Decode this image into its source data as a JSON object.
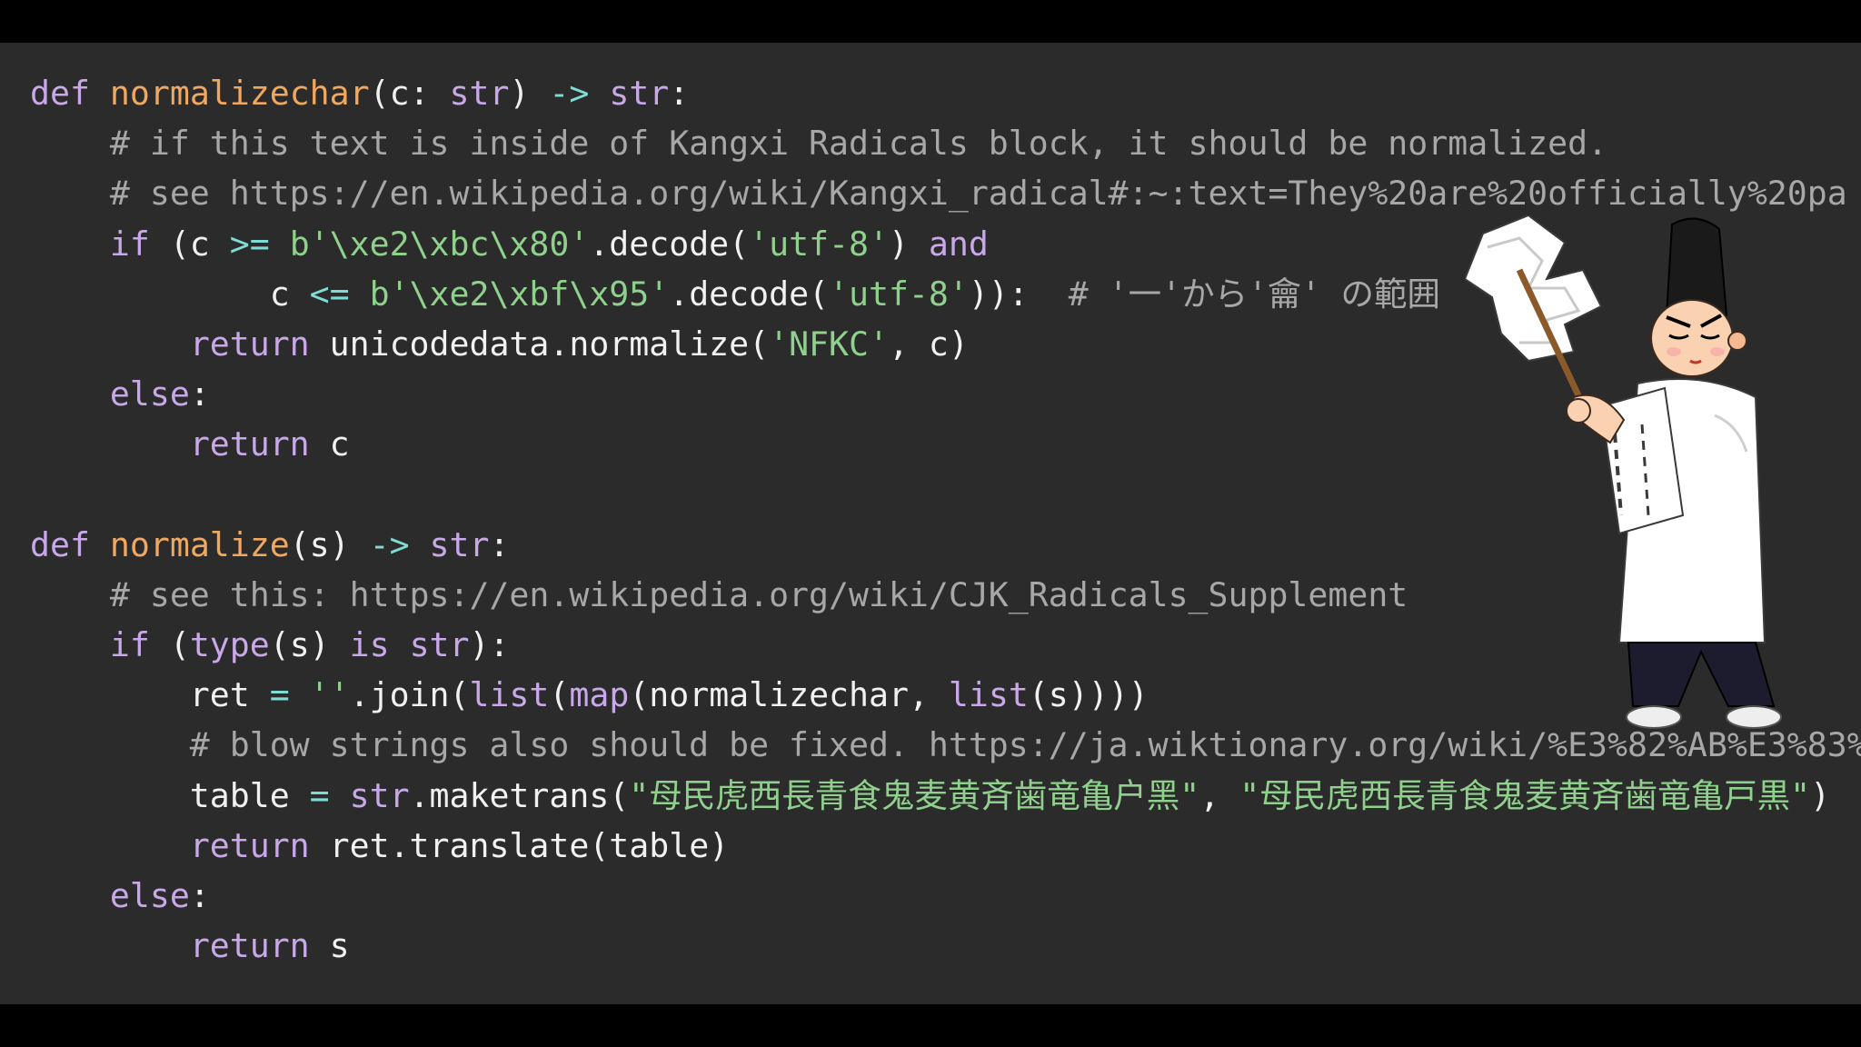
{
  "slide": {
    "code_lines": [
      [
        {
          "t": "def",
          "c": "kw"
        },
        {
          "t": " ",
          "c": "tx"
        },
        {
          "t": "normalizechar",
          "c": "fn"
        },
        {
          "t": "(c: ",
          "c": "tx"
        },
        {
          "t": "str",
          "c": "bi"
        },
        {
          "t": ") ",
          "c": "tx"
        },
        {
          "t": "->",
          "c": "op"
        },
        {
          "t": " ",
          "c": "tx"
        },
        {
          "t": "str",
          "c": "bi"
        },
        {
          "t": ":",
          "c": "tx"
        }
      ],
      [
        {
          "t": "    # if this text is inside of Kangxi Radicals block, it should be normalized.",
          "c": "cm"
        }
      ],
      [
        {
          "t": "    # see https://en.wikipedia.org/wiki/Kangxi_radical#:~:text=They%20are%20officially%20pa",
          "c": "cm"
        }
      ],
      [
        {
          "t": "    ",
          "c": "tx"
        },
        {
          "t": "if",
          "c": "kw"
        },
        {
          "t": " (c ",
          "c": "tx"
        },
        {
          "t": ">=",
          "c": "op"
        },
        {
          "t": " ",
          "c": "tx"
        },
        {
          "t": "b'\\xe2\\xbc\\x80'",
          "c": "str"
        },
        {
          "t": ".decode(",
          "c": "tx"
        },
        {
          "t": "'utf-8'",
          "c": "str"
        },
        {
          "t": ") ",
          "c": "tx"
        },
        {
          "t": "and",
          "c": "kw"
        }
      ],
      [
        {
          "t": "            c ",
          "c": "tx"
        },
        {
          "t": "<=",
          "c": "op"
        },
        {
          "t": " ",
          "c": "tx"
        },
        {
          "t": "b'\\xe2\\xbf\\x95'",
          "c": "str"
        },
        {
          "t": ".decode(",
          "c": "tx"
        },
        {
          "t": "'utf-8'",
          "c": "str"
        },
        {
          "t": ")):  ",
          "c": "tx"
        },
        {
          "t": "# '⼀'から'⿕' の範囲",
          "c": "cm"
        }
      ],
      [
        {
          "t": "        ",
          "c": "tx"
        },
        {
          "t": "return",
          "c": "kw"
        },
        {
          "t": " unicodedata.normalize(",
          "c": "tx"
        },
        {
          "t": "'NFKC'",
          "c": "str"
        },
        {
          "t": ", c)",
          "c": "tx"
        }
      ],
      [
        {
          "t": "    ",
          "c": "tx"
        },
        {
          "t": "else",
          "c": "kw"
        },
        {
          "t": ":",
          "c": "tx"
        }
      ],
      [
        {
          "t": "        ",
          "c": "tx"
        },
        {
          "t": "return",
          "c": "kw"
        },
        {
          "t": " c",
          "c": "tx"
        }
      ],
      [],
      [
        {
          "t": "def",
          "c": "kw"
        },
        {
          "t": " ",
          "c": "tx"
        },
        {
          "t": "normalize",
          "c": "fn"
        },
        {
          "t": "(s) ",
          "c": "tx"
        },
        {
          "t": "->",
          "c": "op"
        },
        {
          "t": " ",
          "c": "tx"
        },
        {
          "t": "str",
          "c": "bi"
        },
        {
          "t": ":",
          "c": "tx"
        }
      ],
      [
        {
          "t": "    # see this: https://en.wikipedia.org/wiki/CJK_Radicals_Supplement",
          "c": "cm"
        }
      ],
      [
        {
          "t": "    ",
          "c": "tx"
        },
        {
          "t": "if",
          "c": "kw"
        },
        {
          "t": " (",
          "c": "tx"
        },
        {
          "t": "type",
          "c": "bi"
        },
        {
          "t": "(s) ",
          "c": "tx"
        },
        {
          "t": "is",
          "c": "kw"
        },
        {
          "t": " ",
          "c": "tx"
        },
        {
          "t": "str",
          "c": "bi"
        },
        {
          "t": "):",
          "c": "tx"
        }
      ],
      [
        {
          "t": "        ret ",
          "c": "tx"
        },
        {
          "t": "=",
          "c": "op"
        },
        {
          "t": " ",
          "c": "tx"
        },
        {
          "t": "''",
          "c": "str"
        },
        {
          "t": ".join(",
          "c": "tx"
        },
        {
          "t": "list",
          "c": "bi"
        },
        {
          "t": "(",
          "c": "tx"
        },
        {
          "t": "map",
          "c": "bi"
        },
        {
          "t": "(normalizechar, ",
          "c": "tx"
        },
        {
          "t": "list",
          "c": "bi"
        },
        {
          "t": "(s))))",
          "c": "tx"
        }
      ],
      [
        {
          "t": "        # blow strings also should be fixed. https://ja.wiktionary.org/wiki/%E3%82%AB%E3%83%",
          "c": "cm"
        }
      ],
      [
        {
          "t": "        table ",
          "c": "tx"
        },
        {
          "t": "=",
          "c": "op"
        },
        {
          "t": " ",
          "c": "tx"
        },
        {
          "t": "str",
          "c": "bi"
        },
        {
          "t": ".maketrans(",
          "c": "tx"
        },
        {
          "t": "\"⺟⺠⻁⻄⻑⻘⻝⻤⻨⻩⻫⻭⻯⻲⼾⿊\"",
          "c": "str"
        },
        {
          "t": ", ",
          "c": "tx"
        },
        {
          "t": "\"母民虎西長青食鬼麦黄斉歯竜亀戸黒\"",
          "c": "str"
        },
        {
          "t": ")",
          "c": "tx"
        }
      ],
      [
        {
          "t": "        ",
          "c": "tx"
        },
        {
          "t": "return",
          "c": "kw"
        },
        {
          "t": " ret.translate(table)",
          "c": "tx"
        }
      ],
      [
        {
          "t": "    ",
          "c": "tx"
        },
        {
          "t": "else",
          "c": "kw"
        },
        {
          "t": ":",
          "c": "tx"
        }
      ],
      [
        {
          "t": "        ",
          "c": "tx"
        },
        {
          "t": "return",
          "c": "kw"
        },
        {
          "t": " s",
          "c": "tx"
        }
      ]
    ]
  },
  "colors": {
    "background": "#2b2b2b",
    "keyword": "#c8a8e8",
    "function_name": "#f0a860",
    "comment": "#a7a7a7",
    "string": "#8fd18c",
    "operator": "#7fdcd4",
    "text": "#f1f1f1"
  },
  "illustration": {
    "icon": "shinto-priest-with-gohei-icon"
  }
}
